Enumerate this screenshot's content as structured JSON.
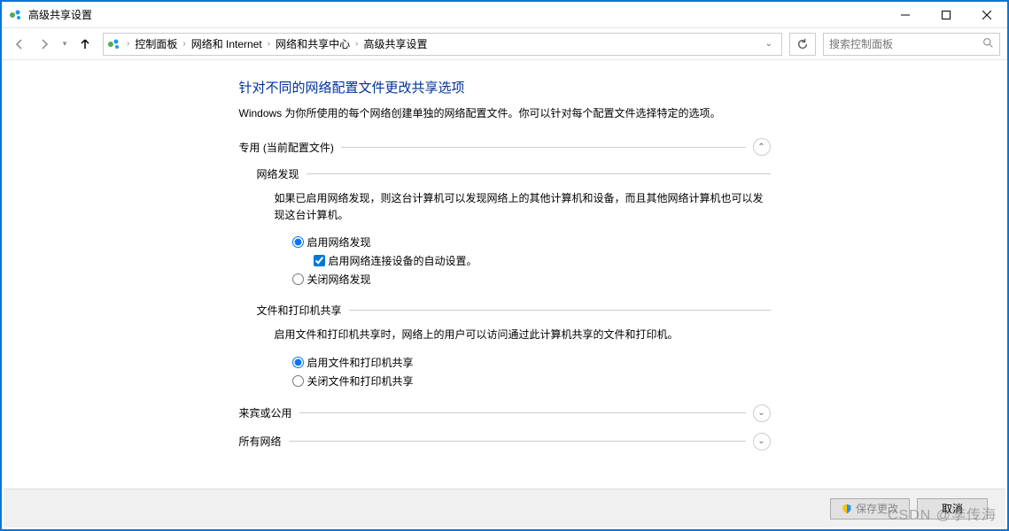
{
  "window": {
    "title": "高级共享设置"
  },
  "breadcrumb": [
    "控制面板",
    "网络和 Internet",
    "网络和共享中心",
    "高级共享设置"
  ],
  "search": {
    "placeholder": "搜索控制面板"
  },
  "page": {
    "heading": "针对不同的网络配置文件更改共享选项",
    "subtext": "Windows 为你所使用的每个网络创建单独的网络配置文件。你可以针对每个配置文件选择特定的选项。"
  },
  "profiles": {
    "private": {
      "label": "专用 (当前配置文件)",
      "discovery": {
        "title": "网络发现",
        "desc": "如果已启用网络发现，则这台计算机可以发现网络上的其他计算机和设备，而且其他网络计算机也可以发现这台计算机。",
        "on": "启用网络发现",
        "auto": "启用网络连接设备的自动设置。",
        "off": "关闭网络发现"
      },
      "fileshare": {
        "title": "文件和打印机共享",
        "desc": "启用文件和打印机共享时，网络上的用户可以访问通过此计算机共享的文件和打印机。",
        "on": "启用文件和打印机共享",
        "off": "关闭文件和打印机共享"
      }
    },
    "guest": {
      "label": "来宾或公用"
    },
    "all": {
      "label": "所有网络"
    }
  },
  "footer": {
    "save": "保存更改",
    "cancel": "取消"
  },
  "watermark": "CSDN @李传海"
}
